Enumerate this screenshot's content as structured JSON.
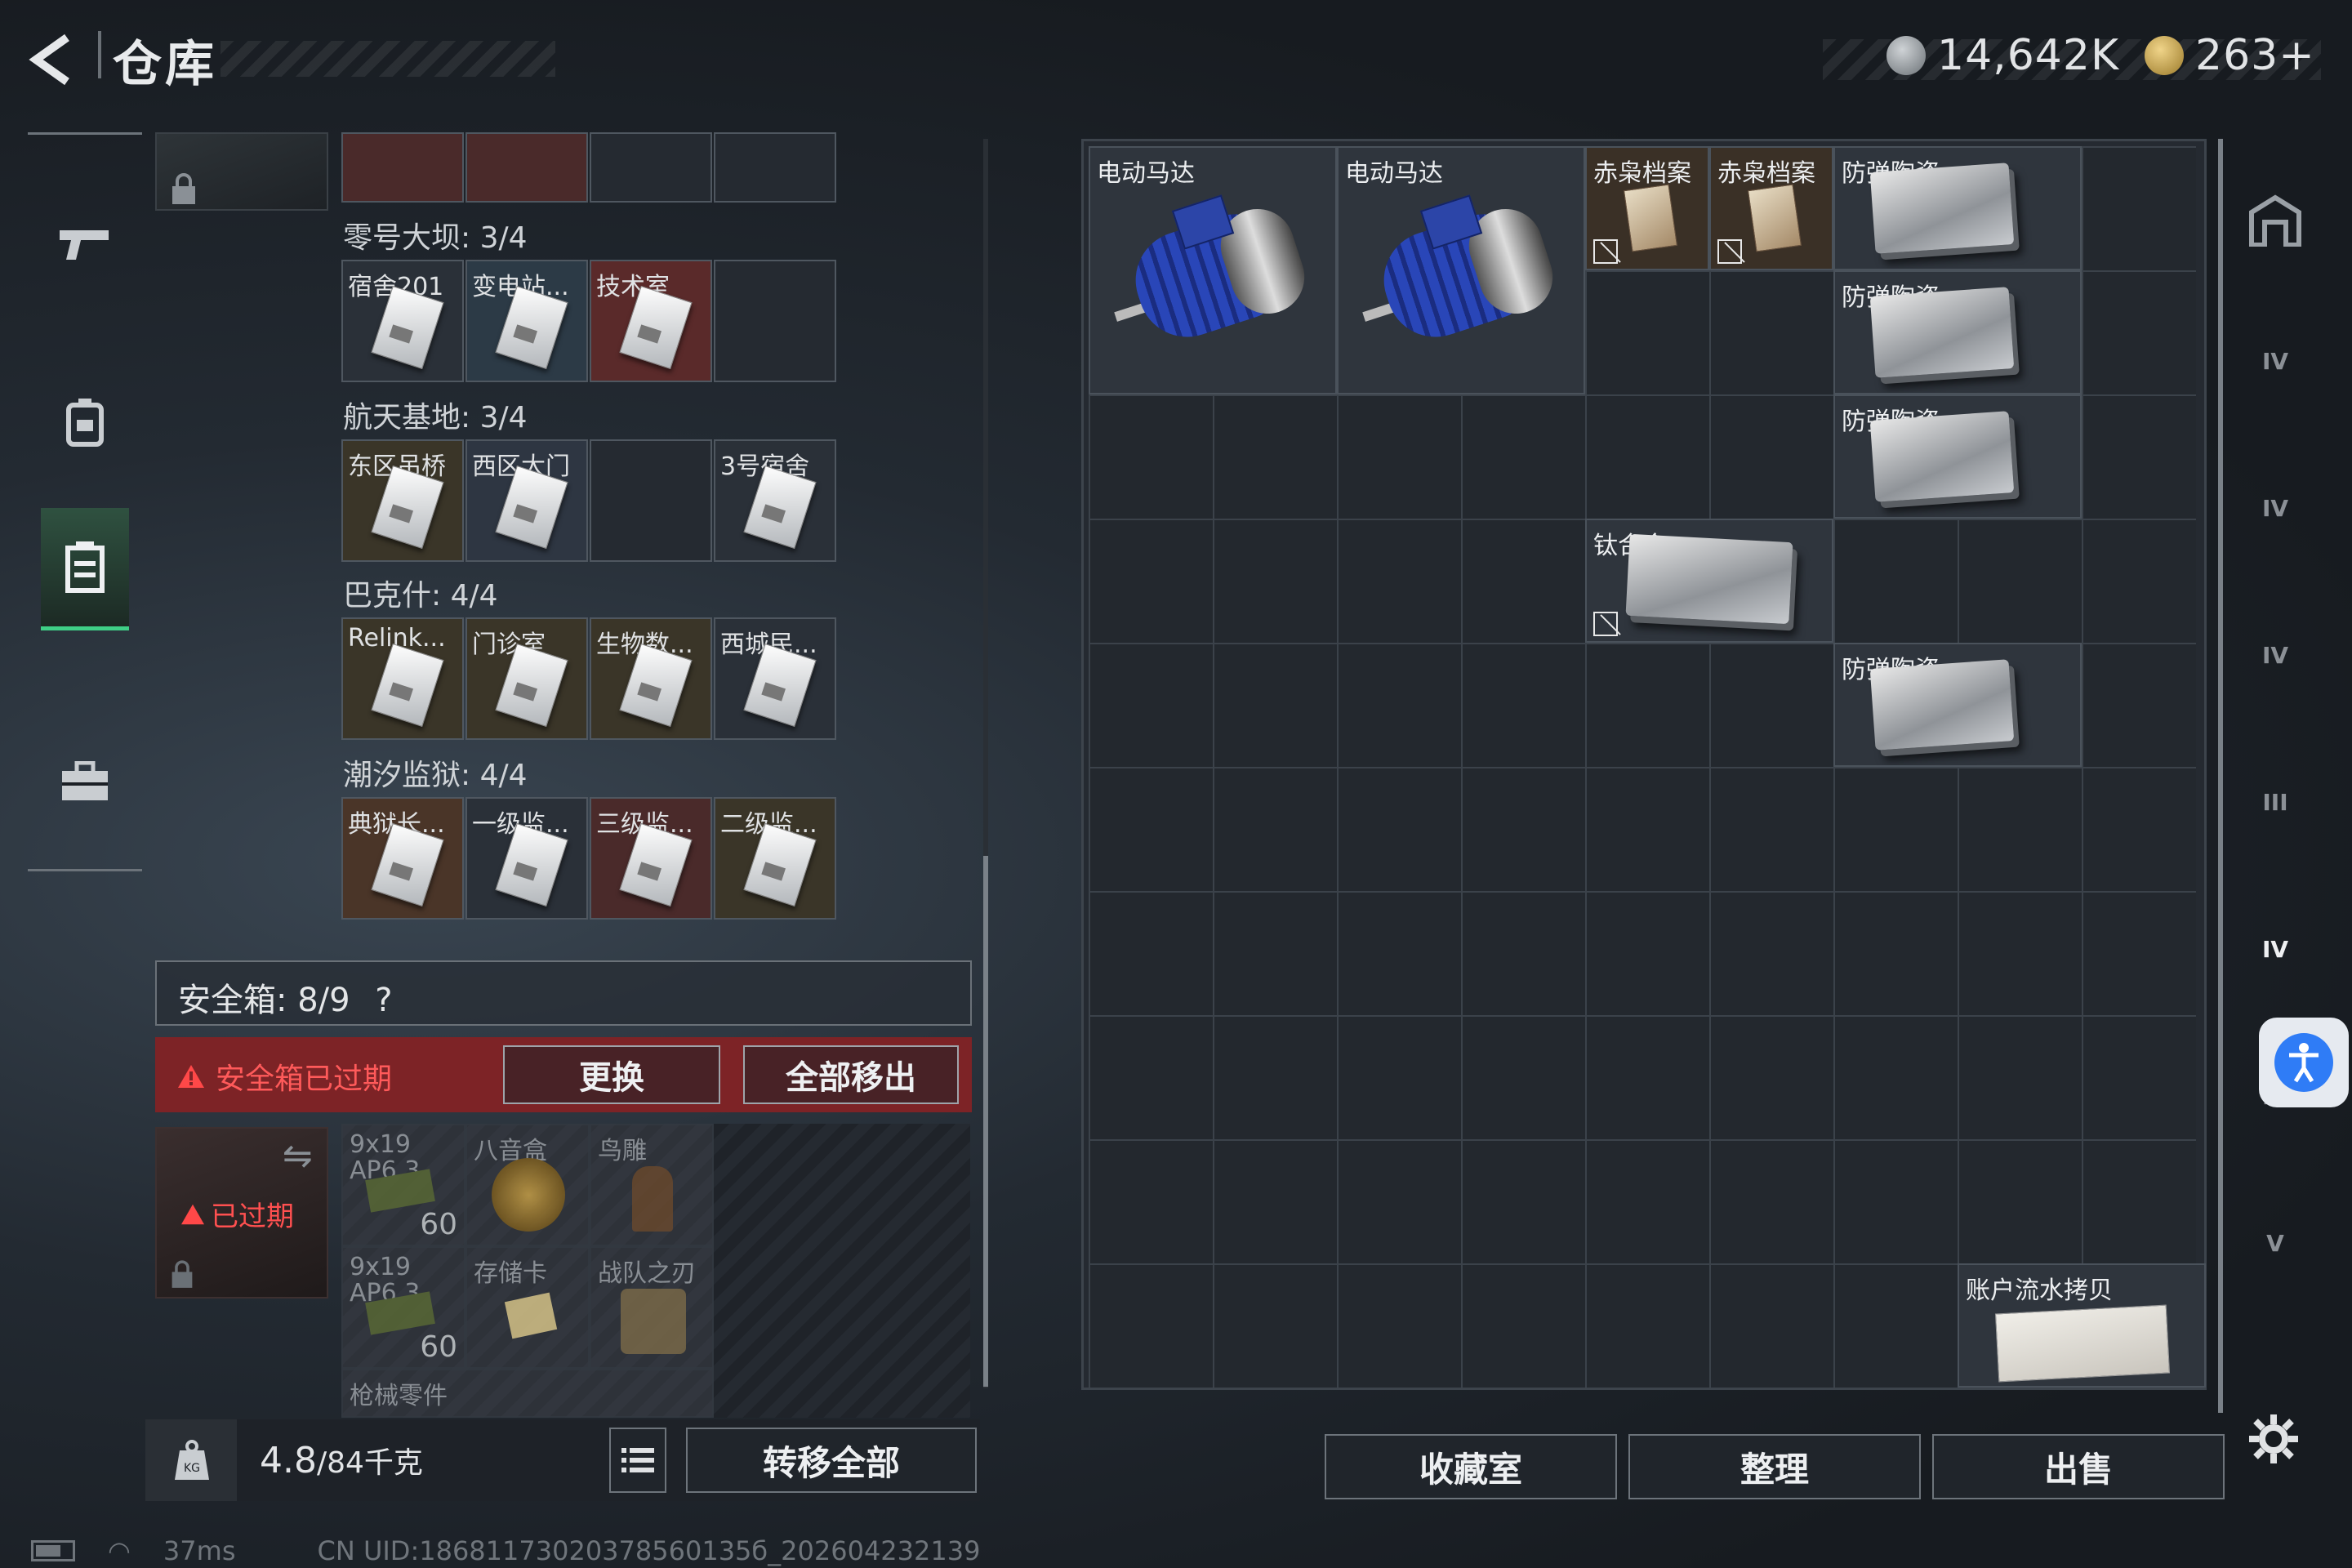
{
  "header": {
    "title": "仓库",
    "currency1": "14,642K",
    "currency2": "263+"
  },
  "nav": [
    "weapon-tab",
    "backpack-tab",
    "storage-tab",
    "toolbox-tab"
  ],
  "keys": {
    "rows": [
      {
        "label": "零号大坝: 3/4",
        "slots": [
          "宿舍201",
          "变电站...",
          "技术室",
          ""
        ]
      },
      {
        "label": "航天基地: 3/4",
        "slots": [
          "东区吊桥",
          "西区大门",
          "",
          "3号宿舍"
        ]
      },
      {
        "label": "巴克什: 4/4",
        "slots": [
          "Relink...",
          "门诊室",
          "生物数...",
          "西城民..."
        ]
      },
      {
        "label": "潮汐监狱: 4/4",
        "slots": [
          "典狱长...",
          "一级监...",
          "三级监...",
          "二级监..."
        ]
      }
    ]
  },
  "safe": {
    "header": "安全箱: 8/9",
    "help": "?",
    "expired_warning": "安全箱已过期",
    "replace_btn": "更换",
    "remove_all_btn": "全部移出",
    "box_label": "已过期",
    "items": [
      {
        "name": "9x19",
        "sub": "AP6.3",
        "count": "60"
      },
      {
        "name": "八音盒",
        "count": ""
      },
      {
        "name": "鸟雕",
        "count": ""
      },
      {
        "name": "9x19",
        "sub": "AP6.3",
        "count": "60"
      },
      {
        "name": "存储卡",
        "count": ""
      },
      {
        "name": "战队之刃",
        "count": ""
      },
      {
        "name": "枪械零件",
        "count": ""
      }
    ]
  },
  "bottom": {
    "weight": "4.8",
    "weight_max": "/84千克",
    "transfer_btn": "转移全部"
  },
  "stash": {
    "items": [
      {
        "name": "电动马达"
      },
      {
        "name": "电动马达"
      },
      {
        "name": "赤枭档案"
      },
      {
        "name": "赤枭档案"
      },
      {
        "name": "防弹陶瓷"
      },
      {
        "name": "防弹陶瓷"
      },
      {
        "name": "防弹陶瓷"
      },
      {
        "name": "钛合金"
      },
      {
        "name": "防弹陶瓷"
      },
      {
        "name": "账户流水拷贝"
      }
    ]
  },
  "actions": {
    "collection": "收藏室",
    "sort": "整理",
    "sell": "出售"
  },
  "right_nav": [
    "IV",
    "IV",
    "IV",
    "III",
    "IV",
    "IV",
    "V"
  ],
  "status": {
    "ping": "37ms",
    "uid": "CN UID:18681173020378560135б_202604232139"
  },
  "colors": {
    "accent": "#3fcf86",
    "danger": "#7d2326",
    "motor": "#2946b8"
  }
}
